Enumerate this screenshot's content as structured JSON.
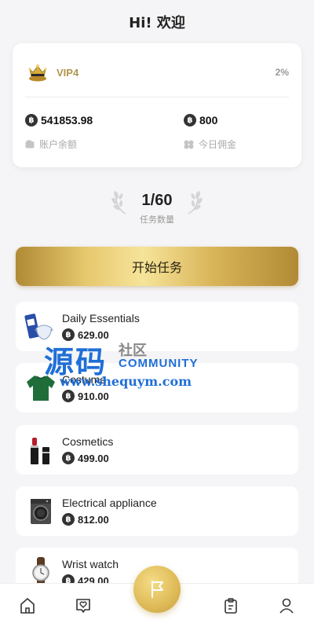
{
  "header": {
    "title": "Hi! 欢迎"
  },
  "account": {
    "vip_level": "VIP4",
    "vip_percent": "2%",
    "balance_value": "541853.98",
    "balance_label": "账户余额",
    "commission_value": "800",
    "commission_label": "今日佣金",
    "coin_symbol": "฿"
  },
  "tasks": {
    "count": "1/60",
    "label": "任务数量",
    "start_label": "开始任务"
  },
  "categories": [
    {
      "name": "Daily Essentials",
      "price": "629.00",
      "icon": "daily-essentials-icon"
    },
    {
      "name": "Costume",
      "price": "910.00",
      "icon": "costume-sweater-icon"
    },
    {
      "name": "Cosmetics",
      "price": "499.00",
      "icon": "cosmetics-lipstick-icon"
    },
    {
      "name": "Electrical appliance",
      "price": "812.00",
      "icon": "washing-machine-icon"
    },
    {
      "name": "Wrist watch",
      "price": "429.00",
      "icon": "wrist-watch-icon"
    }
  ],
  "watermark": {
    "big": "源码",
    "small": "社区",
    "community": "COMMUNITY",
    "url": "www.shequym.com"
  },
  "tabbar": {
    "items": [
      "home-icon",
      "heart-chat-icon",
      "flag-icon",
      "clipboard-icon",
      "user-icon"
    ]
  },
  "colors": {
    "accent": "#c9a14a",
    "vip": "#b0954d",
    "watermark": "#1f6fd6"
  }
}
